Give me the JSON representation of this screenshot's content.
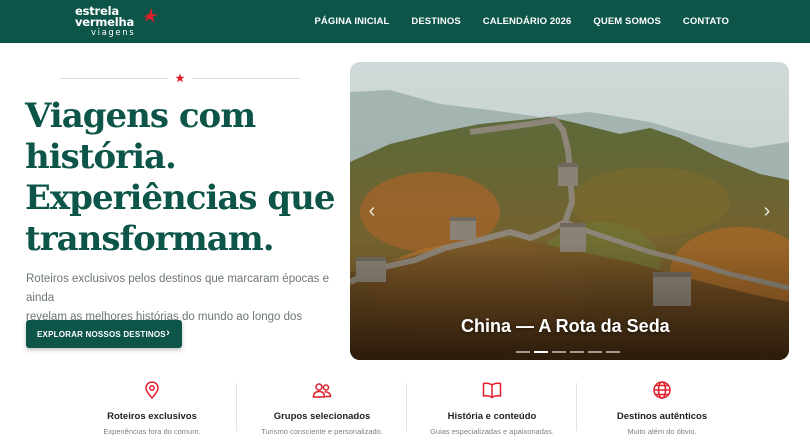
{
  "brand": {
    "line1": "estrela",
    "line2": "vermelha",
    "line3": "viagens",
    "colors": {
      "primary": "#0d5548",
      "accent": "#e11d2a"
    }
  },
  "nav": {
    "items": [
      {
        "label": "PÁGINA INICIAL"
      },
      {
        "label": "DESTINOS"
      },
      {
        "label": "CALENDÁRIO 2026"
      },
      {
        "label": "QUEM SOMOS"
      },
      {
        "label": "CONTATO"
      }
    ]
  },
  "hero": {
    "title_lines": [
      "Viagens com",
      "história.",
      "Experiências que",
      "transformam."
    ],
    "description_lines": [
      "Roteiros exclusivos pelos destinos que marcaram épocas e ainda",
      "revelam as melhores histórias do mundo ao longo dos séculos."
    ],
    "cta_label": "EXPLORAR NOSSOS DESTINOS",
    "cta_icon": "chevron-right-icon",
    "divider_icon": "star-icon"
  },
  "slider": {
    "caption": "China — A Rota da Seda",
    "prev_icon": "chevron-left-icon",
    "next_icon": "chevron-right-icon",
    "dot_count": 6,
    "active_dot": 2
  },
  "features": [
    {
      "icon": "map-pin-icon",
      "title": "Roteiros exclusivos",
      "subtitle": "Experiências fora do comum."
    },
    {
      "icon": "users-icon",
      "title": "Grupos selecionados",
      "subtitle": "Turismo consciente e personalizado."
    },
    {
      "icon": "book-icon",
      "title": "História e conteúdo",
      "subtitle": "Guias especializadas e apaixonadas."
    },
    {
      "icon": "globe-icon",
      "title": "Destinos autênticos",
      "subtitle": "Muito além do óbvio."
    }
  ]
}
